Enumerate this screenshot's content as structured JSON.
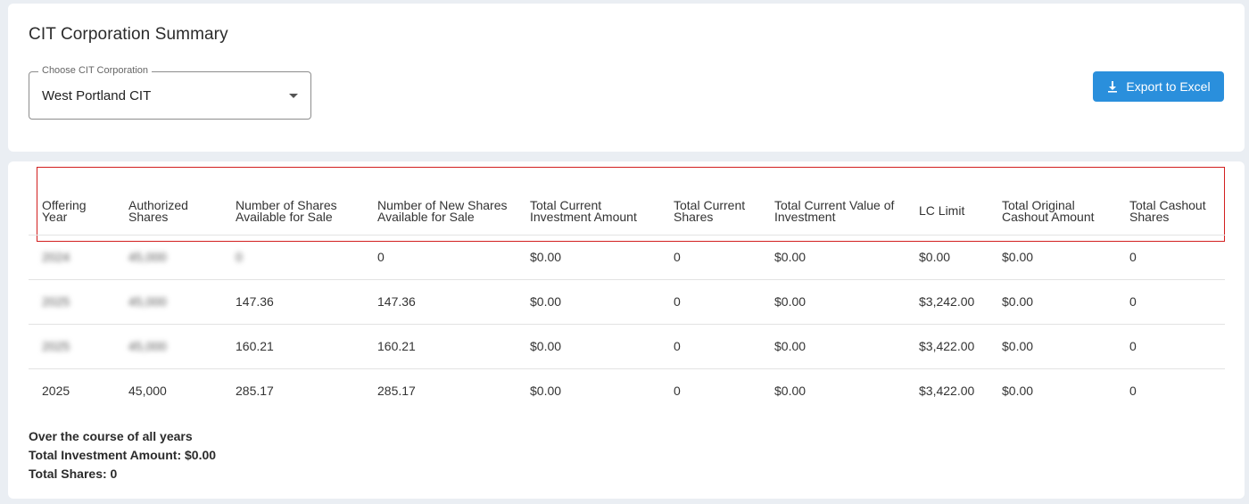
{
  "header": {
    "title": "CIT Corporation Summary",
    "select_label": "Choose CIT Corporation",
    "select_value": "West Portland CIT",
    "export_label": "Export to Excel"
  },
  "table": {
    "columns": [
      "Offering Year",
      "Authorized Shares",
      "Number of Shares Available for Sale",
      "Number of New Shares Available for Sale",
      "Total Current Investment Amount",
      "Total Current Shares",
      "Total Current Value of Investment",
      "LC Limit",
      "Total Original Cashout Amount",
      "Total Cashout Shares"
    ],
    "rows": [
      [
        "2024",
        "45,000",
        "0",
        "0",
        "$0.00",
        "0",
        "$0.00",
        "$0.00",
        "$0.00",
        "0"
      ],
      [
        "2025",
        "45,000",
        "147.36",
        "147.36",
        "$0.00",
        "0",
        "$0.00",
        "$3,242.00",
        "$0.00",
        "0"
      ],
      [
        "2025",
        "45,000",
        "160.21",
        "160.21",
        "$0.00",
        "0",
        "$0.00",
        "$3,422.00",
        "$0.00",
        "0"
      ],
      [
        "2025",
        "45,000",
        "285.17",
        "285.17",
        "$0.00",
        "0",
        "$0.00",
        "$3,422.00",
        "$0.00",
        "0"
      ]
    ],
    "blurred_cells": [
      [
        0,
        0
      ],
      [
        0,
        1
      ],
      [
        0,
        2
      ],
      [
        1,
        0
      ],
      [
        1,
        1
      ],
      [
        2,
        0
      ],
      [
        2,
        1
      ]
    ]
  },
  "summary": {
    "line1": "Over the course of all years",
    "line2": "Total Investment Amount: $0.00",
    "line3": "Total Shares: 0"
  },
  "colors": {
    "accent": "#2a8fdc",
    "highlight": "#d21f1f",
    "background": "#eaeef3"
  }
}
